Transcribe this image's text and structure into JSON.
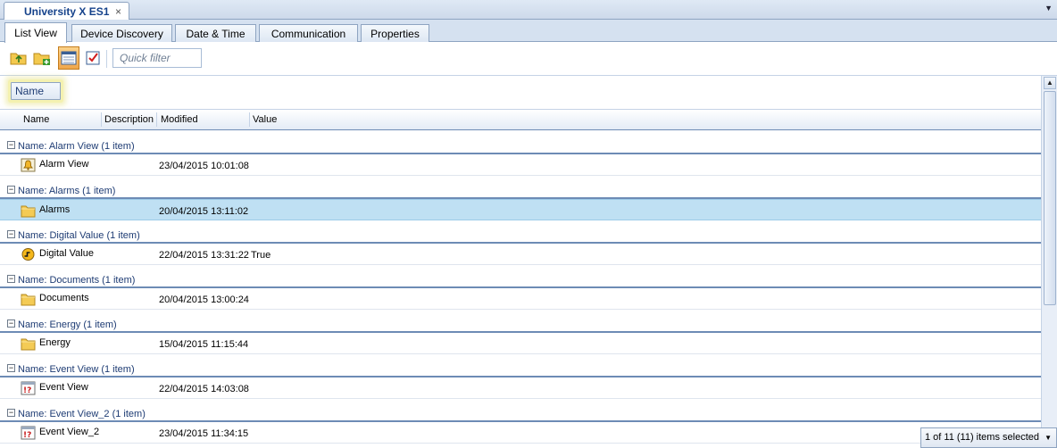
{
  "document_tab": {
    "title": "University X ES1",
    "close_glyph": "×",
    "menu_glyph": "▼"
  },
  "view_tabs": [
    {
      "label": "List View",
      "active": true
    },
    {
      "label": "Device Discovery",
      "active": false
    },
    {
      "label": "Date & Time",
      "active": false
    },
    {
      "label": "Communication",
      "active": false
    },
    {
      "label": "Properties",
      "active": false
    }
  ],
  "toolbar": {
    "buttons": [
      {
        "icon": "folder-up-icon"
      },
      {
        "icon": "folder-add-icon"
      },
      {
        "icon": "list-view-icon",
        "pressed": true
      },
      {
        "icon": "checkbox-check-icon"
      }
    ],
    "quick_filter_placeholder": "Quick filter"
  },
  "group_by": {
    "chip": "Name"
  },
  "columns": [
    "Name",
    "Description",
    "Modified",
    "Value"
  ],
  "groups": [
    {
      "header": "Name: Alarm View (1 item)",
      "item": {
        "name": "Alarm View",
        "icon": "alarm-view-icon",
        "modified": "23/04/2015 10:01:08",
        "value": ""
      }
    },
    {
      "header": "Name: Alarms (1 item)",
      "item": {
        "name": "Alarms",
        "icon": "folder-icon",
        "modified": "20/04/2015 13:11:02",
        "value": "",
        "selected": true
      }
    },
    {
      "header": "Name: Digital Value (1 item)",
      "item": {
        "name": "Digital Value",
        "icon": "digital-value-icon",
        "modified": "22/04/2015 13:31:22",
        "value": "True"
      }
    },
    {
      "header": "Name: Documents (1 item)",
      "item": {
        "name": "Documents",
        "icon": "folder-icon",
        "modified": "20/04/2015 13:00:24",
        "value": ""
      }
    },
    {
      "header": "Name: Energy (1 item)",
      "item": {
        "name": "Energy",
        "icon": "folder-icon",
        "modified": "15/04/2015 11:15:44",
        "value": ""
      }
    },
    {
      "header": "Name: Event View (1 item)",
      "item": {
        "name": "Event View",
        "icon": "event-view-icon",
        "modified": "22/04/2015 14:03:08",
        "value": ""
      }
    },
    {
      "header": "Name: Event View_2 (1 item)",
      "item": {
        "name": "Event View_2",
        "icon": "event-view-icon",
        "modified": "23/04/2015 11:34:15",
        "value": ""
      }
    }
  ],
  "status": {
    "text": "1 of 11 (11) items selected",
    "dropdown_glyph": "▼"
  },
  "scrollbar": {
    "up_glyph": "▲"
  },
  "colors": {
    "accent": "#15428b",
    "selection": "#bfe0f3",
    "group_line": "#6d8bb5"
  }
}
